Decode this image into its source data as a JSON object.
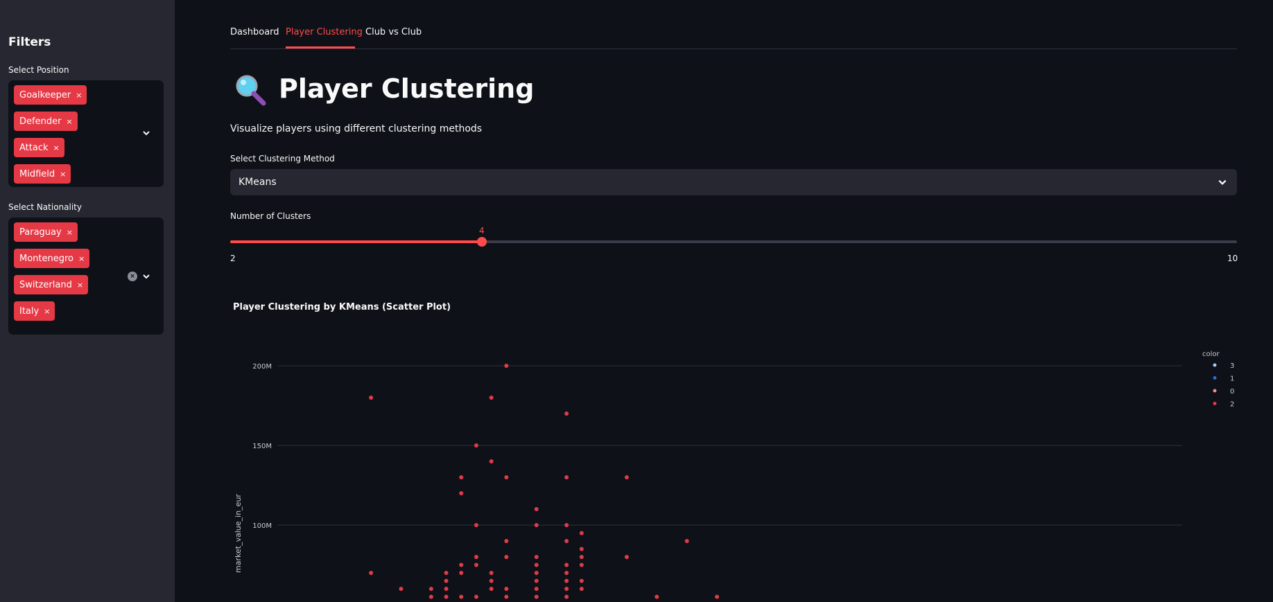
{
  "sidebar": {
    "title": "Filters",
    "position": {
      "label": "Select Position",
      "tags": [
        "Goalkeeper",
        "Defender",
        "Attack",
        "Midfield"
      ]
    },
    "nationality": {
      "label": "Select Nationality",
      "tags": [
        "Paraguay",
        "Montenegro",
        "Switzerland",
        "Italy"
      ]
    },
    "remove_glyph": "×",
    "clear_glyph": "×"
  },
  "tabs": [
    {
      "label": "Dashboard",
      "active": false
    },
    {
      "label": "Player Clustering",
      "active": true
    },
    {
      "label": "Club vs Club",
      "active": false
    }
  ],
  "page": {
    "icon": "magnifier-icon",
    "title": "Player Clustering",
    "caption": "Visualize players using different clustering methods"
  },
  "method_select": {
    "label": "Select Clustering Method",
    "value": "KMeans"
  },
  "clusters_slider": {
    "label": "Number of Clusters",
    "min": 2,
    "max": 10,
    "value": 4,
    "min_label": "2",
    "max_label": "10",
    "value_label": "4"
  },
  "colors": {
    "accent": "#ff4b4b",
    "tag": "#e63946",
    "cluster_3": "#a6c8f0",
    "cluster_1": "#2a6fd6",
    "cluster_0": "#f58c92",
    "cluster_2": "#e23a4a"
  },
  "chart_data": {
    "type": "scatter",
    "title": "Player Clustering by KMeans (Scatter Plot)",
    "xlabel": "",
    "ylabel": "market_value_in_eur",
    "yticks": [
      {
        "value": 200000000,
        "label": "200M"
      },
      {
        "value": 150000000,
        "label": "150M"
      },
      {
        "value": 100000000,
        "label": "100M"
      }
    ],
    "x_unlabeled_range": [
      0,
      31
    ],
    "ylim_visible": [
      20000000,
      205000000
    ],
    "legend": {
      "title": "color",
      "placement": "top-right",
      "entries": [
        {
          "name": "3",
          "color": "#a6c8f0"
        },
        {
          "name": "1",
          "color": "#2a6fd6"
        },
        {
          "name": "0",
          "color": "#f58c92"
        },
        {
          "name": "2",
          "color": "#e23a4a"
        }
      ]
    },
    "series": [
      {
        "name": "2",
        "color": "#e23a4a",
        "points": [
          [
            12,
            200000000
          ],
          [
            3,
            180000000
          ],
          [
            11,
            180000000
          ],
          [
            16,
            170000000
          ],
          [
            10,
            150000000
          ],
          [
            11,
            140000000
          ],
          [
            9,
            130000000
          ],
          [
            12,
            130000000
          ],
          [
            16,
            130000000
          ],
          [
            20,
            130000000
          ],
          [
            9,
            120000000
          ],
          [
            14,
            110000000
          ],
          [
            10,
            100000000
          ],
          [
            14,
            100000000
          ],
          [
            16,
            100000000
          ],
          [
            17,
            95000000
          ],
          [
            12,
            90000000
          ],
          [
            16,
            90000000
          ],
          [
            24,
            90000000
          ],
          [
            17,
            85000000
          ],
          [
            10,
            80000000
          ],
          [
            12,
            80000000
          ],
          [
            14,
            80000000
          ],
          [
            17,
            80000000
          ],
          [
            20,
            80000000
          ],
          [
            9,
            75000000
          ],
          [
            10,
            75000000
          ],
          [
            14,
            75000000
          ],
          [
            16,
            75000000
          ],
          [
            17,
            75000000
          ],
          [
            3,
            70000000
          ],
          [
            8,
            70000000
          ],
          [
            9,
            70000000
          ],
          [
            11,
            70000000
          ],
          [
            14,
            70000000
          ],
          [
            16,
            70000000
          ],
          [
            8,
            65000000
          ],
          [
            11,
            65000000
          ],
          [
            14,
            65000000
          ],
          [
            16,
            65000000
          ],
          [
            17,
            65000000
          ],
          [
            5,
            60000000
          ],
          [
            7,
            60000000
          ],
          [
            8,
            60000000
          ],
          [
            11,
            60000000
          ],
          [
            12,
            60000000
          ],
          [
            14,
            60000000
          ],
          [
            16,
            60000000
          ],
          [
            17,
            60000000
          ],
          [
            7,
            55000000
          ],
          [
            8,
            55000000
          ],
          [
            9,
            55000000
          ],
          [
            10,
            55000000
          ],
          [
            12,
            55000000
          ],
          [
            14,
            55000000
          ],
          [
            16,
            55000000
          ],
          [
            22,
            55000000
          ],
          [
            26,
            55000000
          ]
        ]
      }
    ]
  }
}
